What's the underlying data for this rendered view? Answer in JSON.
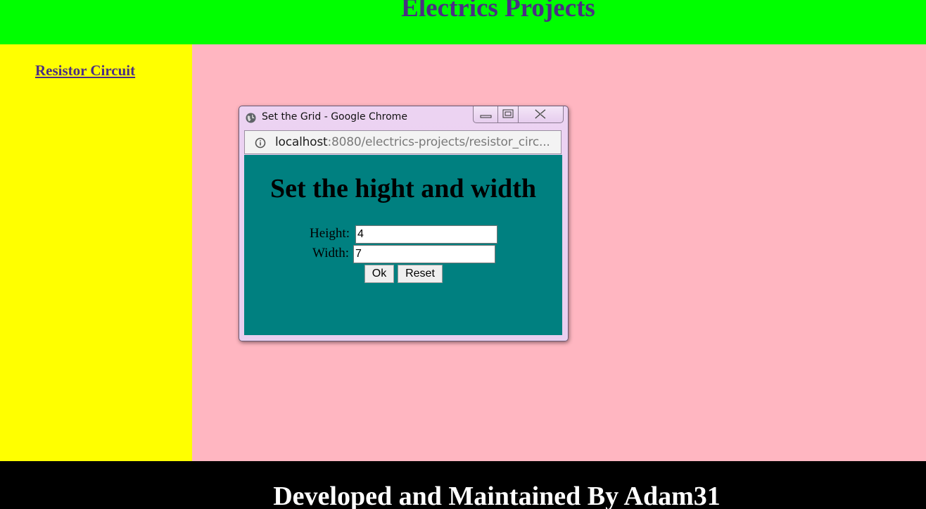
{
  "header": {
    "title": "Electrics Projects"
  },
  "sidebar": {
    "link_label": "Resistor Circuit"
  },
  "footer": {
    "text": "Developed and Maintained By Adam31"
  },
  "popup": {
    "window_title": "Set the Grid - Google Chrome",
    "address": {
      "host": "localhost",
      "rest": ":8080/electrics-projects/resistor_circ..."
    },
    "heading": "Set the hight and width",
    "height_label": "Height:",
    "height_value": "4",
    "width_label": "Width:",
    "width_value": "7",
    "ok_label": "Ok",
    "reset_label": "Reset"
  },
  "colors": {
    "header_bg": "#00ff00",
    "sidebar_bg": "#ffff00",
    "main_bg": "#ffb6c1",
    "footer_bg": "#000000",
    "popup_content_bg": "#008080",
    "title_text": "#4b2e83"
  },
  "icons": {
    "popup_favicon": "globe-icon",
    "address_info": "info-icon",
    "minimize": "minimize-icon",
    "maximize": "maximize-icon",
    "close": "close-icon"
  }
}
